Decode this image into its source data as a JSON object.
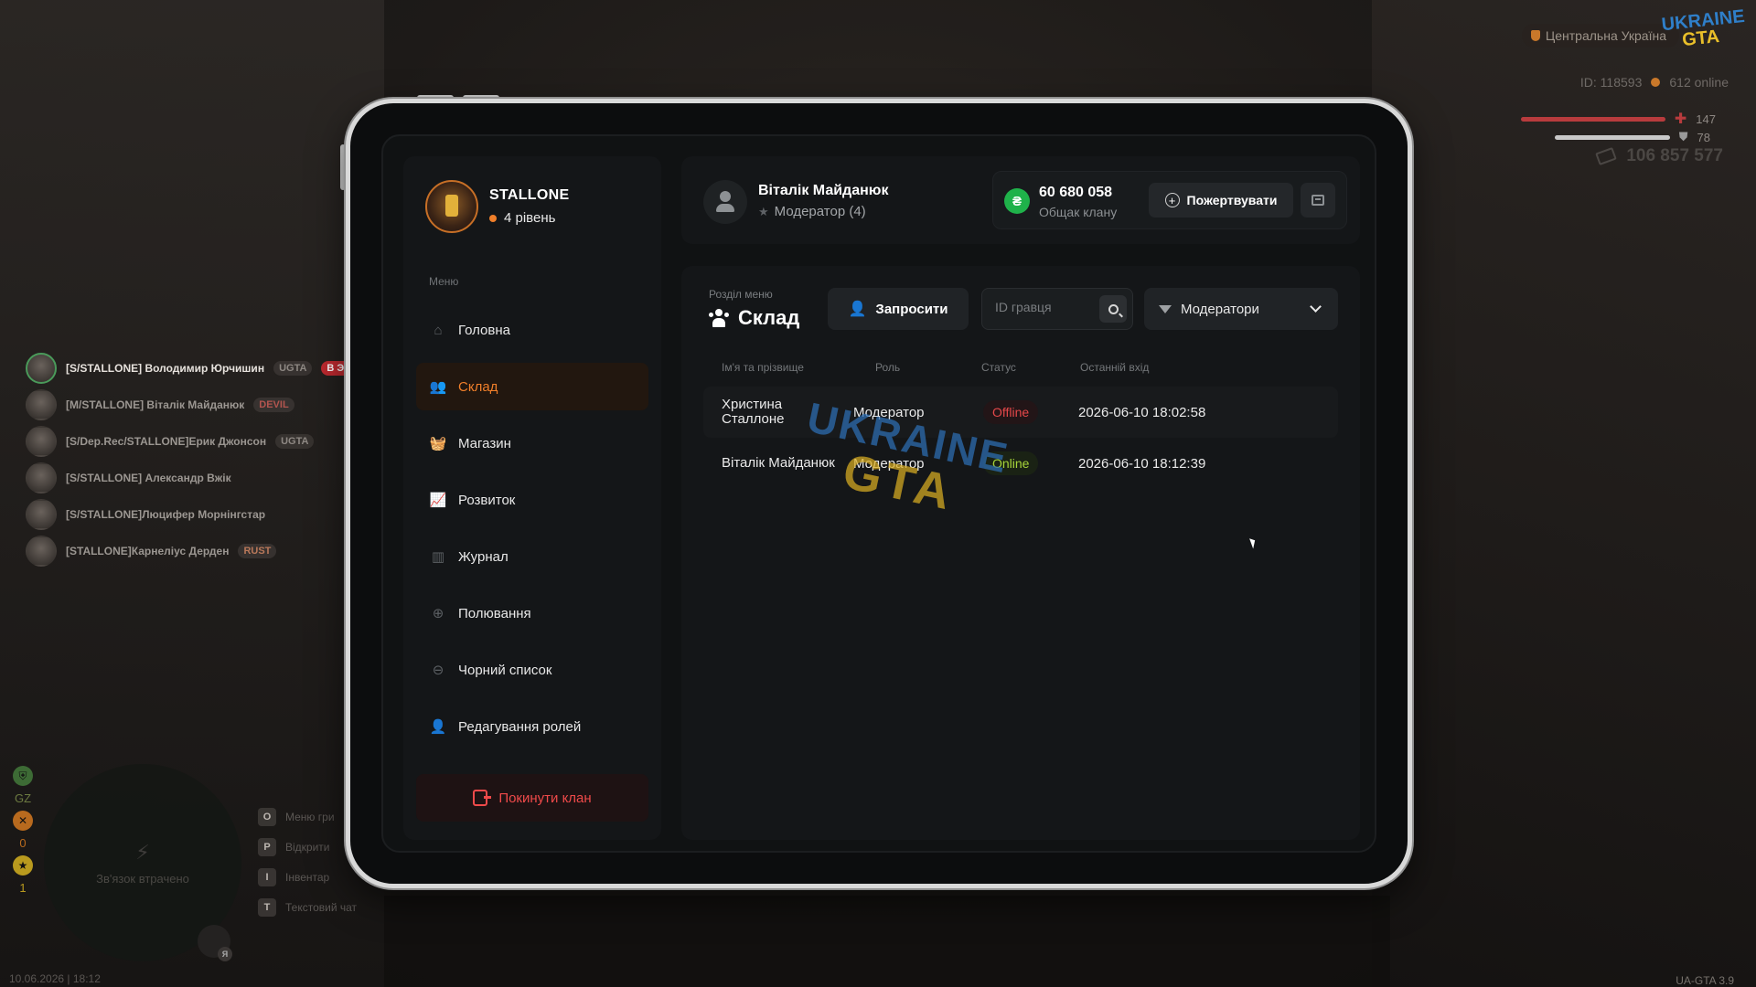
{
  "hud": {
    "region": "Центральна Україна",
    "logo_line1": "UKRAINE",
    "logo_line2": "GTA",
    "player_id": "ID: 118593",
    "online": "612 online",
    "health": "147",
    "armor": "78",
    "money": "106 857 577",
    "datetime": "10.06.2026 | 18:12",
    "version": "UA-GTA 3.9",
    "minimap_text": "Зв'язок втрачено",
    "minimap_counters": [
      "GZ",
      "0",
      "1"
    ],
    "keys": [
      {
        "key": "O",
        "label": "Меню гри"
      },
      {
        "key": "P",
        "label": "Відкрити"
      },
      {
        "key": "I",
        "label": "Інвентар"
      },
      {
        "key": "T",
        "label": "Текстовий чат"
      }
    ],
    "mic_badge": "Я"
  },
  "voice_list": [
    {
      "name": "[S/STALLONE] Володимир Юрчишин",
      "tag": "UGTA",
      "extra": "В ЭФИРЕ",
      "active": true
    },
    {
      "name": "[M/STALLONE] Віталік Майданюк",
      "tag": "DEVIL"
    },
    {
      "name": "[S/Dep.Rec/STALLONE]Ерик Джонсон",
      "tag": "UGTA"
    },
    {
      "name": "[S/STALLONE] Александр Вжік"
    },
    {
      "name": "[S/STALLONE]Люцифер Морнінгстар"
    },
    {
      "name": "[STALLONE]Карнеліус Дерден",
      "tag": "RUST"
    }
  ],
  "clan": {
    "name": "STALLONE",
    "level": "4 рівень"
  },
  "menu": {
    "caption": "Меню",
    "items": [
      {
        "label": "Головна",
        "icon": "home-icon"
      },
      {
        "label": "Склад",
        "icon": "people-icon",
        "active": true
      },
      {
        "label": "Магазин",
        "icon": "basket-icon"
      },
      {
        "label": "Розвиток",
        "icon": "chart-icon"
      },
      {
        "label": "Журнал",
        "icon": "book-icon"
      },
      {
        "label": "Полювання",
        "icon": "crosshair-icon"
      },
      {
        "label": "Чорний список",
        "icon": "block-icon"
      },
      {
        "label": "Редагування ролей",
        "icon": "user-edit-icon"
      }
    ],
    "leave": "Покинути клан"
  },
  "user": {
    "name": "Віталік Майданюк",
    "role": "Модератор (4)"
  },
  "balance": {
    "value": "60 680 058",
    "label": "Общак клану",
    "currency_symbol": "₴",
    "donate": "Пожертвувати"
  },
  "section": {
    "caption": "Розділ меню",
    "title": "Склад",
    "invite": "Запросити",
    "search_placeholder": "ID гравця",
    "filter": "Модератори"
  },
  "table": {
    "columns": [
      "Ім'я та прізвище",
      "Роль",
      "Статус",
      "Останній вхід"
    ],
    "rows": [
      {
        "name": "Христина Сталлоне",
        "role": "Модератор",
        "status": "Offline",
        "last_login": "2026-06-10 18:02:58"
      },
      {
        "name": "Віталік Майданюк",
        "role": "Модератор",
        "status": "Online",
        "last_login": "2026-06-10 18:12:39"
      }
    ]
  },
  "watermark": {
    "line1": "UKRAINE",
    "line2": "GTA"
  },
  "colors": {
    "accent": "#f07f2a",
    "danger": "#ef4a4a",
    "online": "#a6d43a",
    "offline": "#e5484a",
    "coin": "#1fb24a"
  }
}
